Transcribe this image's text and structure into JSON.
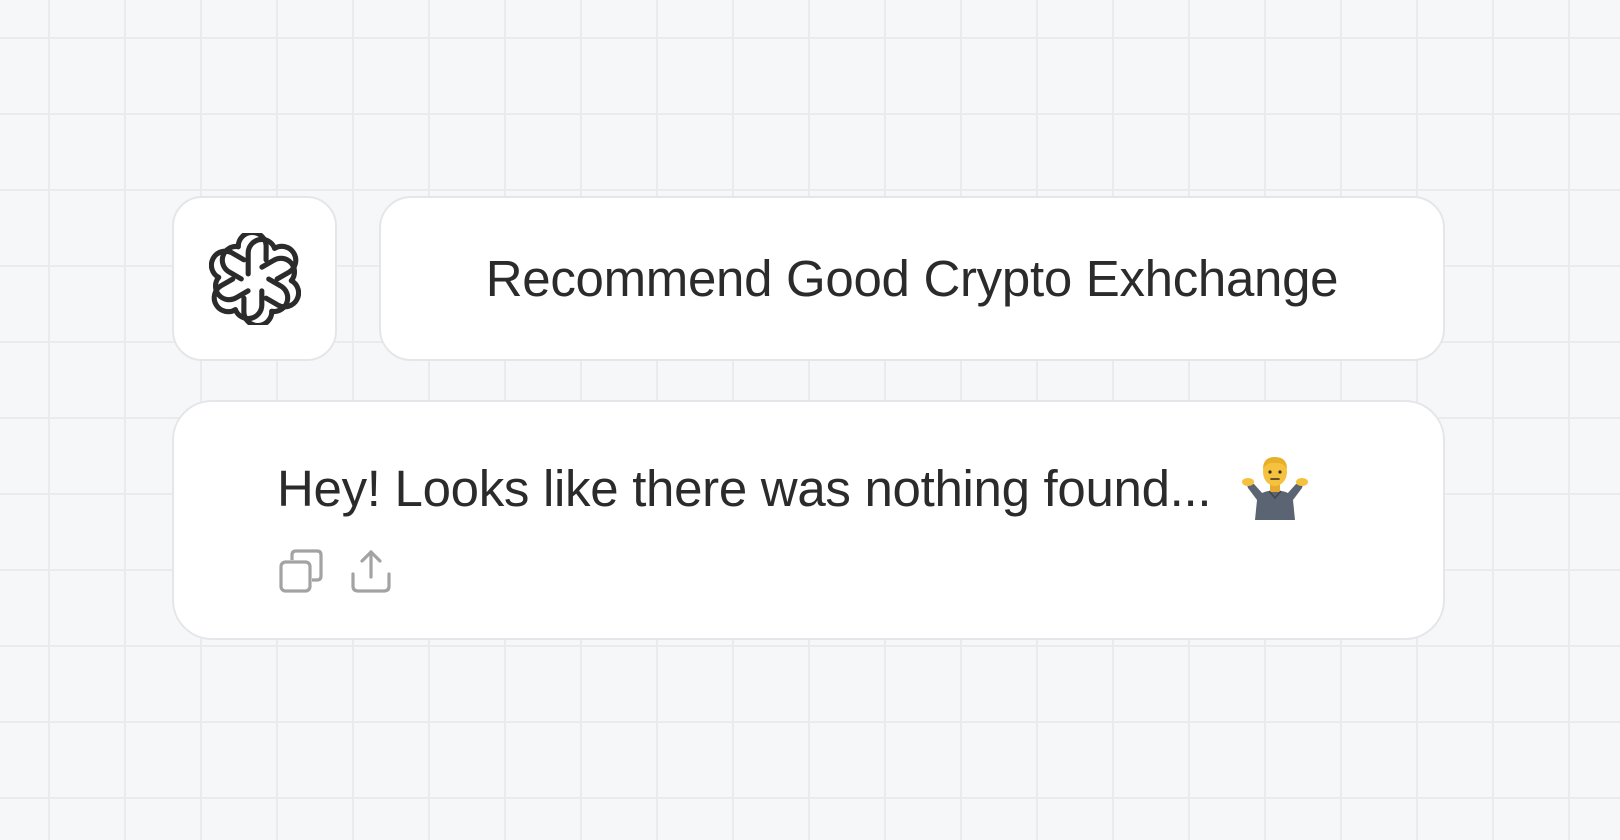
{
  "prompt": {
    "text": "Recommend Good Crypto Exhchange"
  },
  "reply": {
    "text": "Hey! Looks like there was nothing found...",
    "emoji_icon": "person-shrugging-icon"
  },
  "actions": {
    "copy_icon": "copy-icon",
    "share_icon": "share-icon"
  },
  "colors": {
    "background": "#f6f7f9",
    "grid": "#e9ebee",
    "card": "#ffffff",
    "card_border": "#e5e6e9",
    "text": "#2b2b2b",
    "action_icon": "#a3a3a3"
  },
  "logo": {
    "icon": "openai-logo-icon"
  }
}
